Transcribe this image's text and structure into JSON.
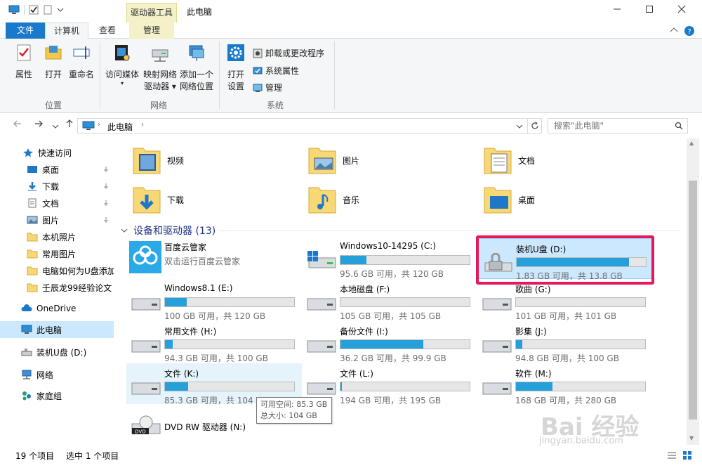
{
  "titlebar": {
    "context_tab": "驱动器工具",
    "title": "此电脑"
  },
  "tabs": {
    "file": "文件",
    "computer": "计算机",
    "view": "查看",
    "manage": "管理"
  },
  "ribbon": {
    "properties": "属性",
    "open": "打开",
    "rename": "重命名",
    "location_group": "位置",
    "access_media": "访问媒体",
    "map_drive_l1": "映射网络",
    "map_drive_l2": "驱动器",
    "add_location_l1": "添加一个",
    "add_location_l2": "网络位置",
    "network_group": "网络",
    "open_settings_l1": "打开",
    "open_settings_l2": "设置",
    "uninstall": "卸载或更改程序",
    "sys_props": "系统属性",
    "manage": "管理",
    "system_group": "系统"
  },
  "address": {
    "crumb": "此电脑",
    "search_placeholder": "搜索\"此电脑\""
  },
  "nav": {
    "quick_access": "快速访问",
    "desktop": "桌面",
    "downloads": "下载",
    "documents": "文档",
    "pictures": "图片",
    "local_photos": "本机照片",
    "common_pics": "常用图片",
    "howto_usb": "电脑如何为U盘添加",
    "renchenlong": "壬辰龙99经验论文",
    "onedrive": "OneDrive",
    "this_pc": "此电脑",
    "usb_drive": "装机U盘 (D:)",
    "network": "网络",
    "homegroup": "家庭组"
  },
  "folders": {
    "videos": "视频",
    "pictures": "图片",
    "documents": "文档",
    "downloads": "下载",
    "music": "音乐",
    "desktop": "桌面"
  },
  "section": {
    "title": "设备和驱动器 (13)"
  },
  "drives": {
    "baidu_name": "百度云管家",
    "baidu_sub": "双击运行百度云管家",
    "c_name": "Windows10-14295 (C:)",
    "c_space": "95.6 GB 可用，共 120 GB",
    "c_used": 0.2,
    "d_name": "装机U盘 (D:)",
    "d_space": "1.83 GB 可用，共 13.8 GB",
    "d_used": 0.87,
    "e_name": "Windows8.1 (E:)",
    "e_space": "100 GB 可用，共 120 GB",
    "e_used": 0.17,
    "f_name": "本地磁盘 (F:)",
    "f_space": "105 GB 可用，共 105 GB",
    "f_used": 0.0,
    "g_name": "歌曲 (G:)",
    "g_space": "101 GB 可用，共 101 GB",
    "g_used": 0.0,
    "h_name": "常用文件 (H:)",
    "h_space": "94.3 GB 可用，共 100 GB",
    "h_used": 0.06,
    "i_name": "备份文件 (I:)",
    "i_space": "36.2 GB 可用，共 99.9 GB",
    "i_used": 0.64,
    "j_name": "影集 (J:)",
    "j_space": "94.8 GB 可用，共 100 GB",
    "j_used": 0.05,
    "k_name": "文件 (K:)",
    "k_space": "85.3 GB 可用，共 104 GB",
    "k_used": 0.18,
    "l_name": "文件 (L:)",
    "l_space": "194 GB 可用，共 195 GB",
    "l_used": 0.01,
    "m_name": "软件 (M:)",
    "m_space": "168 GB 可用，共 280 GB",
    "m_used": 0.28,
    "n_name": "DVD RW 驱动器 (N:)"
  },
  "tooltip": {
    "free": "可用空间: 85.3 GB",
    "total": "总大小: 104 GB"
  },
  "status": {
    "count": "19 个项目",
    "selected": "选中 1 个项目"
  },
  "watermark": {
    "brand": "Bai 经验",
    "url": "jingyan.baidu.com"
  },
  "colors": {
    "accent": "#1979ca",
    "bar_fill": "#26a0da",
    "highlight": "#e4185a"
  }
}
